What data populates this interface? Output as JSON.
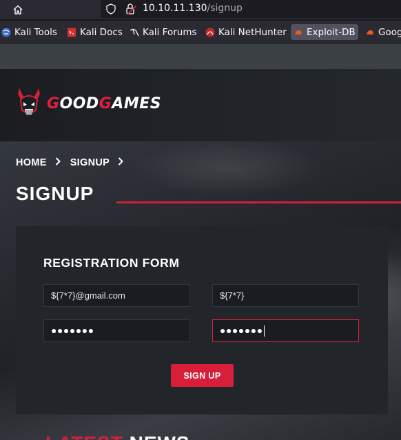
{
  "browser": {
    "url_host": "10.10.11.130",
    "url_path": "/signup",
    "bookmarks": [
      {
        "label": "Kali Tools",
        "icon": "kali-tools-icon"
      },
      {
        "label": "Kali Docs",
        "icon": "kali-docs-icon"
      },
      {
        "label": "Kali Forums",
        "icon": "kali-forums-icon"
      },
      {
        "label": "Kali NetHunter",
        "icon": "kali-nethunter-icon"
      },
      {
        "label": "Exploit-DB",
        "icon": "exploit-db-icon"
      },
      {
        "label": "Goog",
        "icon": "exploit-db-icon"
      }
    ]
  },
  "site": {
    "logo_first": "G",
    "logo_mid1": "OOD",
    "logo_mid2": "G",
    "logo_end": "AMES"
  },
  "breadcrumb": [
    "HOME",
    "SIGNUP"
  ],
  "page_title": "SIGNUP",
  "form": {
    "title": "REGISTRATION FORM",
    "email_value": "${7*7}@gmail.com",
    "name_value": "${7*7}",
    "password_value": "●●●●●●●",
    "confirm_value": "●●●●●●●",
    "submit_label": "SIGN UP"
  },
  "latest": {
    "first": "LATEST",
    "second": " NEWS"
  },
  "colors": {
    "accent": "#d81f3a",
    "card": "#22262b"
  }
}
